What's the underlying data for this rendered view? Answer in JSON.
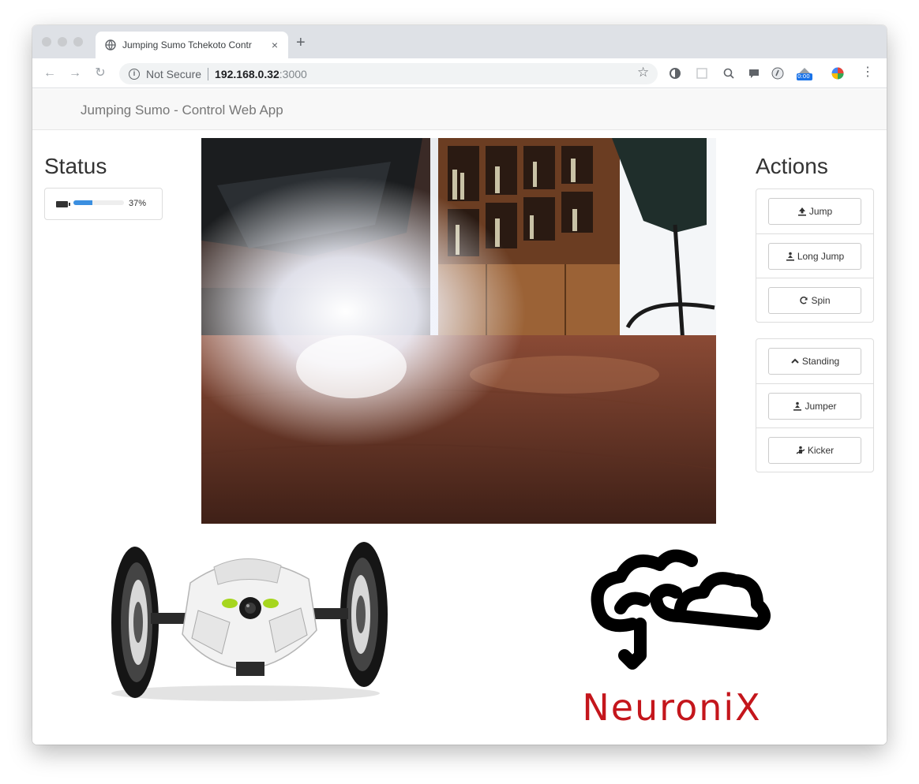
{
  "browser": {
    "tab_title": "Jumping Sumo Tchekoto Contr",
    "tab_close": "×",
    "new_tab": "+",
    "address": {
      "security_label": "Not Secure",
      "host": "192.168.0.32",
      "port": ":3000"
    },
    "extension_badge": "0:00"
  },
  "app": {
    "brand": "Jumping Sumo - Control Web App"
  },
  "status": {
    "heading": "Status",
    "battery_percent": 37,
    "battery_label": "37%"
  },
  "actions": {
    "heading": "Actions",
    "group1": [
      {
        "label": "Jump",
        "icon": "upload-icon"
      },
      {
        "label": "Long Jump",
        "icon": "person-jump-icon"
      },
      {
        "label": "Spin",
        "icon": "refresh-icon"
      }
    ],
    "group2": [
      {
        "label": "Standing",
        "icon": "chevron-up-icon"
      },
      {
        "label": "Jumper",
        "icon": "person-jump-icon"
      },
      {
        "label": "Kicker",
        "icon": "kicker-icon"
      }
    ]
  },
  "logo": {
    "text": "NeuroniX",
    "color": "#c4161c"
  },
  "colors": {
    "progress": "#3b8fe0",
    "navbar": "#f8f8f8"
  }
}
